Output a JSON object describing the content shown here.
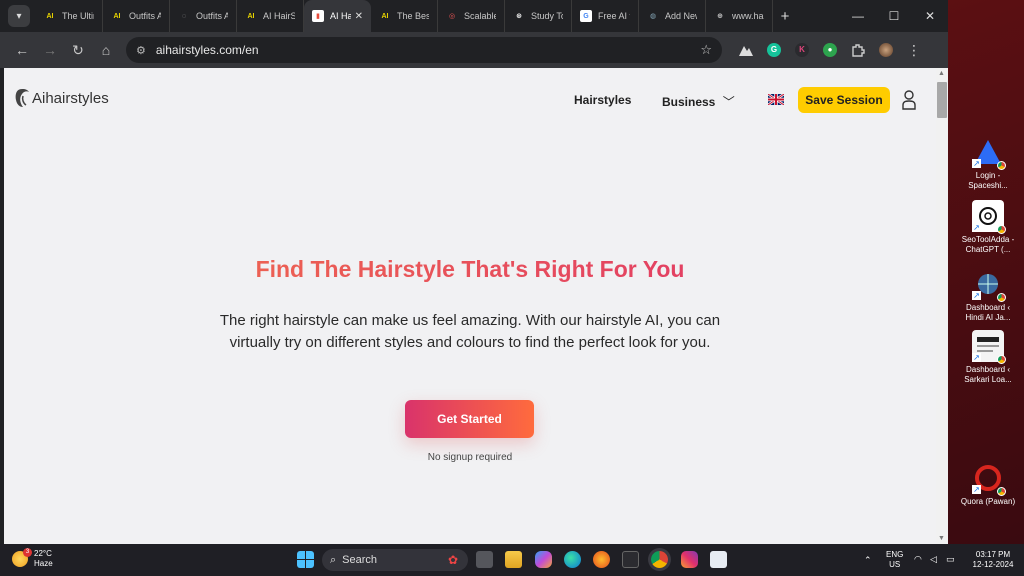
{
  "browser": {
    "tabs": [
      {
        "title": "The Ultimate",
        "favicon": "AI",
        "color": "#1c1c1c"
      },
      {
        "title": "Outfits AI",
        "favicon": "AI",
        "color": "#1c1c1c"
      },
      {
        "title": "Outfits AI",
        "favicon": "◌",
        "color": "#444"
      },
      {
        "title": "AI HairStyle",
        "favicon": "AI",
        "color": "#1c1c1c"
      },
      {
        "title": "AI Hairstyles",
        "favicon": "▮",
        "color": "#e74c3c",
        "active": true
      },
      {
        "title": "The Best",
        "favicon": "AI",
        "color": "#1c1c1c"
      },
      {
        "title": "Scalable",
        "favicon": "◎",
        "color": "#d33"
      },
      {
        "title": "Study Tools",
        "favicon": "⊛",
        "color": "#222"
      },
      {
        "title": "Free AI tools",
        "favicon": "G",
        "color": "#fff"
      },
      {
        "title": "Add New",
        "favicon": "◍",
        "color": "#6b8fc2"
      },
      {
        "title": "www.hairstyle",
        "favicon": "⊕",
        "color": "#888"
      }
    ],
    "url": "aihairstyles.com/en"
  },
  "site": {
    "logo": "Aihairstyles",
    "nav": {
      "hairstyles": "Hairstyles",
      "business": "Business"
    },
    "save_session": "Save Session",
    "hero_title": "Find The Hairstyle That's Right For You",
    "hero_text": "The right hairstyle can make us feel amazing. With our hairstyle AI, you can virtually try on different styles and colours to find the perfect look for you.",
    "cta": "Get Started",
    "note": "No signup required"
  },
  "desktop_icons": [
    {
      "label": "Login - Spaceshi...",
      "color": "#2d6cf6"
    },
    {
      "label": "SeoToolAdda - ChatGPT (...",
      "color": "#ffffff"
    },
    {
      "label": "Dashboard ‹ Hindi AI Ja...",
      "color": "#3a6aa0"
    },
    {
      "label": "Dashboard ‹ Sarkari Loa...",
      "color": "#f4f4f4"
    },
    {
      "label": "Quora (Pawan)",
      "color": "#b92b27"
    }
  ],
  "taskbar": {
    "temperature": "22°C",
    "weather": "Haze",
    "weather_badge": "3",
    "search_placeholder": "Search",
    "lang": "ENG",
    "region": "US",
    "time": "03:17 PM",
    "date": "12-12-2024"
  }
}
